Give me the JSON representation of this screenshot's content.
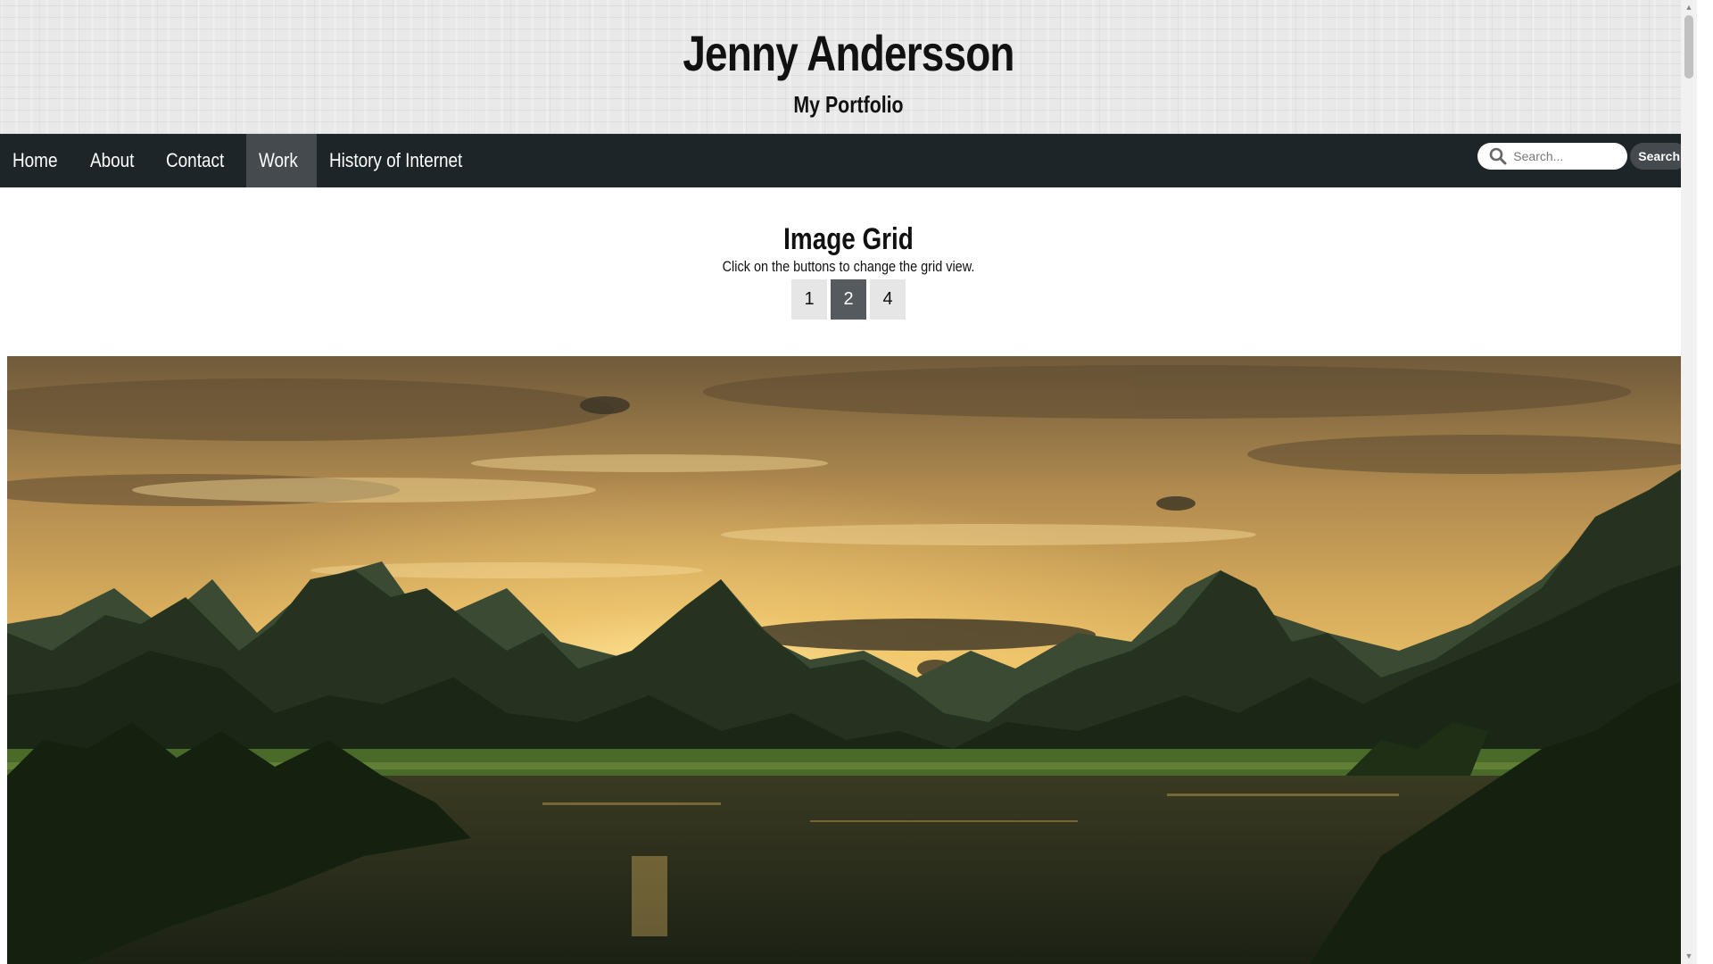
{
  "header": {
    "title": "Jenny Andersson",
    "subtitle": "My Portfolio"
  },
  "nav": {
    "items": [
      {
        "label": "Home"
      },
      {
        "label": "About"
      },
      {
        "label": "Contact"
      },
      {
        "label": "Work",
        "active": true
      },
      {
        "label": "History of Internet"
      }
    ],
    "search": {
      "icon": "search-icon",
      "placeholder": "Search...",
      "button_label": "Search"
    }
  },
  "main": {
    "heading": "Image Grid",
    "instructions": "Click on the buttons to change the grid view.",
    "view_buttons": [
      {
        "label": "1"
      },
      {
        "label": "2",
        "active": true
      },
      {
        "label": "4"
      }
    ]
  },
  "colors": {
    "nav_background": "#1e2528",
    "nav_active": "#444a4d",
    "button_active": "#555a5e",
    "button_inactive": "#e6e6e6"
  }
}
